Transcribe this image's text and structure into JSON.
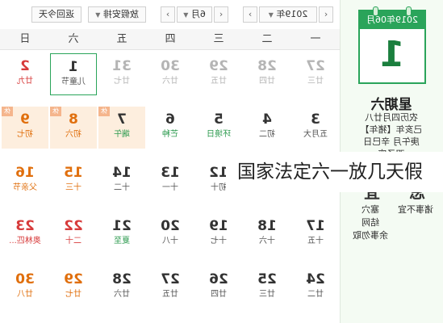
{
  "left_panel": {
    "calendar_header": "2019年06月",
    "day_number": "1",
    "weekday": "星期六",
    "lunar_lines": [
      "农历四月廿八",
      "己亥年【猪年】",
      "庚午月 辛巳日",
      "双子座"
    ],
    "ji_title": "忌",
    "yi_title": "宜",
    "ji_items": [
      "诸事不宜"
    ],
    "yi_items": [
      "塞穴",
      "结网",
      "余事勿取"
    ]
  },
  "toolbar": {
    "back_today_label": "返回今天",
    "holiday_select_label": "放假安排",
    "month_select_label": "6月",
    "year_select_label": "2019年",
    "prev_arrow": "‹",
    "next_arrow": "›",
    "caret": "▼"
  },
  "week_header": [
    "一",
    "二",
    "三",
    "四",
    "五",
    "六",
    "日"
  ],
  "calendar_rows": [
    [
      {
        "d": "27",
        "s": "廿三",
        "style": "muted"
      },
      {
        "d": "28",
        "s": "廿四",
        "style": "muted"
      },
      {
        "d": "29",
        "s": "廿五",
        "style": "muted"
      },
      {
        "d": "30",
        "s": "廿六",
        "style": "muted"
      },
      {
        "d": "31",
        "s": "廿七",
        "style": "muted"
      },
      {
        "d": "1",
        "s": "儿童节",
        "style": "today"
      },
      {
        "d": "2",
        "s": "廿九",
        "style": "red"
      }
    ],
    [
      {
        "d": "3",
        "s": "五月大",
        "style": ""
      },
      {
        "d": "4",
        "s": "初二",
        "style": ""
      },
      {
        "d": "5",
        "s": "环境日",
        "style": "",
        "s_green": true
      },
      {
        "d": "6",
        "s": "芒种",
        "style": "",
        "s_green": true
      },
      {
        "d": "7",
        "s": "端午",
        "style": "holiday",
        "tag": "休",
        "s_green": true
      },
      {
        "d": "8",
        "s": "初六",
        "style": "holiday orange",
        "tag": "休"
      },
      {
        "d": "9",
        "s": "初七",
        "style": "holiday orange",
        "tag": "休"
      }
    ],
    [
      {
        "d": "10",
        "s": "初八",
        "style": ""
      },
      {
        "d": "11",
        "s": "初九",
        "style": ""
      },
      {
        "d": "12",
        "s": "初十",
        "style": ""
      },
      {
        "d": "13",
        "s": "十一",
        "style": ""
      },
      {
        "d": "14",
        "s": "十二",
        "style": ""
      },
      {
        "d": "15",
        "s": "十三",
        "style": "orange"
      },
      {
        "d": "16",
        "s": "父亲节",
        "style": "orange"
      }
    ],
    [
      {
        "d": "17",
        "s": "十五",
        "style": ""
      },
      {
        "d": "18",
        "s": "十六",
        "style": ""
      },
      {
        "d": "19",
        "s": "十七",
        "style": ""
      },
      {
        "d": "20",
        "s": "十八",
        "style": ""
      },
      {
        "d": "21",
        "s": "夏至",
        "style": "",
        "s_green": true
      },
      {
        "d": "22",
        "s": "二十",
        "style": "red"
      },
      {
        "d": "23",
        "s": "奥林匹...",
        "style": "red"
      }
    ],
    [
      {
        "d": "24",
        "s": "廿二",
        "style": ""
      },
      {
        "d": "25",
        "s": "廿三",
        "style": ""
      },
      {
        "d": "26",
        "s": "廿四",
        "style": ""
      },
      {
        "d": "27",
        "s": "廿五",
        "style": ""
      },
      {
        "d": "28",
        "s": "廿六",
        "style": ""
      },
      {
        "d": "29",
        "s": "廿七",
        "style": "orange"
      },
      {
        "d": "30",
        "s": "廿八",
        "style": "orange"
      }
    ]
  ],
  "overlay_caption": "国家法定六一放几天假"
}
